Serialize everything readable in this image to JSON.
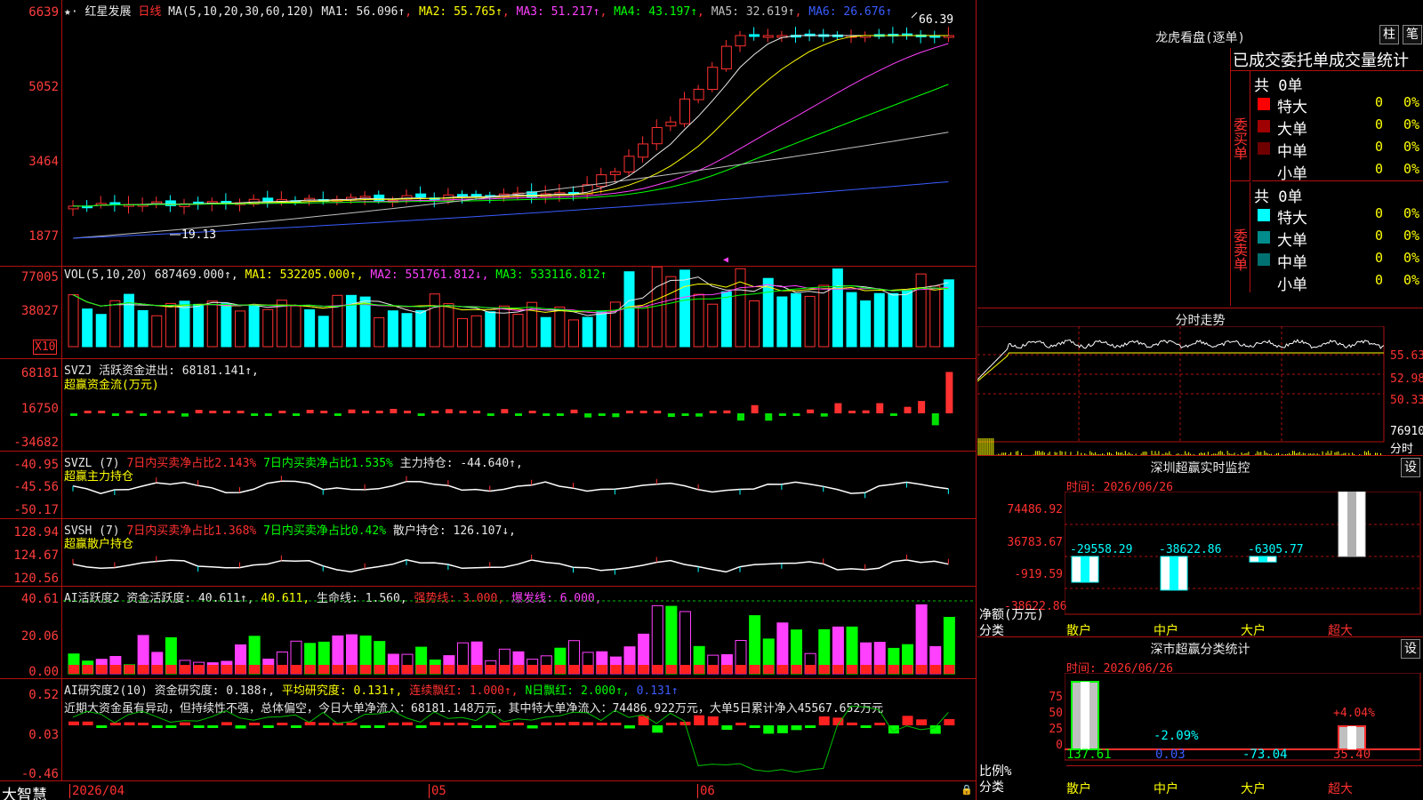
{
  "stock": {
    "name": "红星发展",
    "period": "日线",
    "ma_params": "MA(5,10,20,30,60,120)",
    "ma": [
      {
        "label": "MA1: 56.096↑",
        "color": "#e8e8e8"
      },
      {
        "label": "MA2: 55.765↑",
        "color": "#ffff00"
      },
      {
        "label": "MA3: 51.217↑",
        "color": "#ff40ff"
      },
      {
        "label": "MA4: 43.197↑",
        "color": "#00ff00"
      },
      {
        "label": "MA5: 32.619↑",
        "color": "#c0c0c0"
      },
      {
        "label": "MA6: 26.676↑",
        "color": "#3a5cff"
      }
    ],
    "high_label": "66.39",
    "low_label": "19.13",
    "y_ticks": [
      "6639",
      "5052",
      "3464",
      "1877"
    ]
  },
  "vol": {
    "header": "VOL(5,10,20) 687469.000↑,",
    "ma1": "MA1: 532205.000↑,",
    "ma2": "MA2: 551761.812↓,",
    "ma3": "MA3: 533116.812↑",
    "y_ticks": [
      "77005",
      "38027"
    ],
    "unit": "X10"
  },
  "svzj": {
    "header": "SVZJ  活跃资金进出: 68181.141↑,",
    "sub": "超赢资金流(万元)",
    "y_ticks": [
      "68181",
      "16750",
      "-34682"
    ]
  },
  "svzl": {
    "name": "SVZL (7)",
    "a": "7日内买卖净占比2.143%",
    "b": "7日内买卖净占比1.535%",
    "c": "主力持仓: -44.640↑,",
    "sub": "超赢主力持仓",
    "y_ticks": [
      "-40.95",
      "-45.56",
      "-50.17"
    ]
  },
  "svsh": {
    "name": "SVSH (7)",
    "a": "7日内买卖净占比1.368%",
    "b": "7日内买卖净占比0.42%",
    "c": "散户持仓: 126.107↓,",
    "sub": "超赢散户持仓",
    "y_ticks": [
      "128.94",
      "124.67",
      "120.56"
    ]
  },
  "ai1": {
    "name": "AI活跃度2",
    "a": "资金活跃度: 40.611↑,",
    "b": "40.611,",
    "c": "生命线: 1.560,",
    "d": "强势线: 3.000,",
    "e": "爆发线: 6.000,",
    "y_ticks": [
      "40.61",
      "20.06",
      "0.00"
    ]
  },
  "ai2": {
    "name": "AI研究度2(10)",
    "a": "资金研究度: 0.188↑,",
    "b": "平均研究度: 0.131↑,",
    "c": "连续飘红: 1.000↑,",
    "d": "N日飘红: 2.000↑,",
    "e": "0.131↑",
    "comment": "近期大资金虽有异动，但持续性不强，总体偏空，今日大单净流入：68181.148万元，其中特大单净流入：74486.922万元，大单5日累计净入45567.652万元",
    "y_ticks": [
      "0.52",
      "0.03",
      "-0.46"
    ]
  },
  "footer": {
    "brand": "大智慧",
    "dates": [
      "2026/04",
      "05",
      "06"
    ]
  },
  "dragon": {
    "title": "龙虎看盘(逐单)",
    "btn1": "柱",
    "btn2": "笔",
    "subtitle": "已成交委托单成交量统计",
    "buy_label": "委买单",
    "sell_label": "委卖单",
    "buy_total": "共 0单",
    "sell_total": "共 0单",
    "buy_rows": [
      {
        "name": "特大",
        "v": "0",
        "p": "0%",
        "color": "#ff0000"
      },
      {
        "name": "大单",
        "v": "0",
        "p": "0%",
        "color": "#a00000"
      },
      {
        "name": "中单",
        "v": "0",
        "p": "0%",
        "color": "#700000"
      },
      {
        "name": "小单",
        "v": "0",
        "p": "0%",
        "color": "#000000"
      }
    ],
    "sell_rows": [
      {
        "name": "特大",
        "v": "0",
        "p": "0%",
        "color": "#00ffff"
      },
      {
        "name": "大单",
        "v": "0",
        "p": "0%",
        "color": "#008c8c"
      },
      {
        "name": "中单",
        "v": "0",
        "p": "0%",
        "color": "#007070"
      },
      {
        "name": "小单",
        "v": "0",
        "p": "0%",
        "color": "#000000"
      }
    ]
  },
  "intraday": {
    "title": "分时走势",
    "prices": [
      "55.63",
      "52.98",
      "50.33"
    ],
    "vol": "76910",
    "vol_unit": "分时"
  },
  "sz_monitor": {
    "title": "深圳超赢实时监控",
    "btn": "设",
    "time": "时间: 2026/06/26",
    "y_ticks": [
      "74486.92",
      "36783.67",
      "-919.59",
      "-38622.86"
    ],
    "y_unit": "净额(万元)",
    "x_unit": "分类",
    "cats": [
      "散户",
      "中户",
      "大户",
      "超大"
    ],
    "values": [
      "-29558.29",
      "-38622.86",
      "-6305.77",
      "74486.92"
    ]
  },
  "sz_stats": {
    "title": "深市超赢分类统计",
    "btn": "设",
    "time": "时间: 2026/06/26",
    "y_ticks": [
      "75",
      "50",
      "25",
      "0"
    ],
    "y_unit": "比例%",
    "x_unit": "分类",
    "cats": [
      "散户",
      "中户",
      "大户",
      "超大"
    ],
    "values": [
      "137.61",
      "0.03",
      "-73.04",
      "35.40"
    ],
    "labels": [
      "",
      "-2.09%",
      "",
      "+4.04%"
    ]
  }
}
